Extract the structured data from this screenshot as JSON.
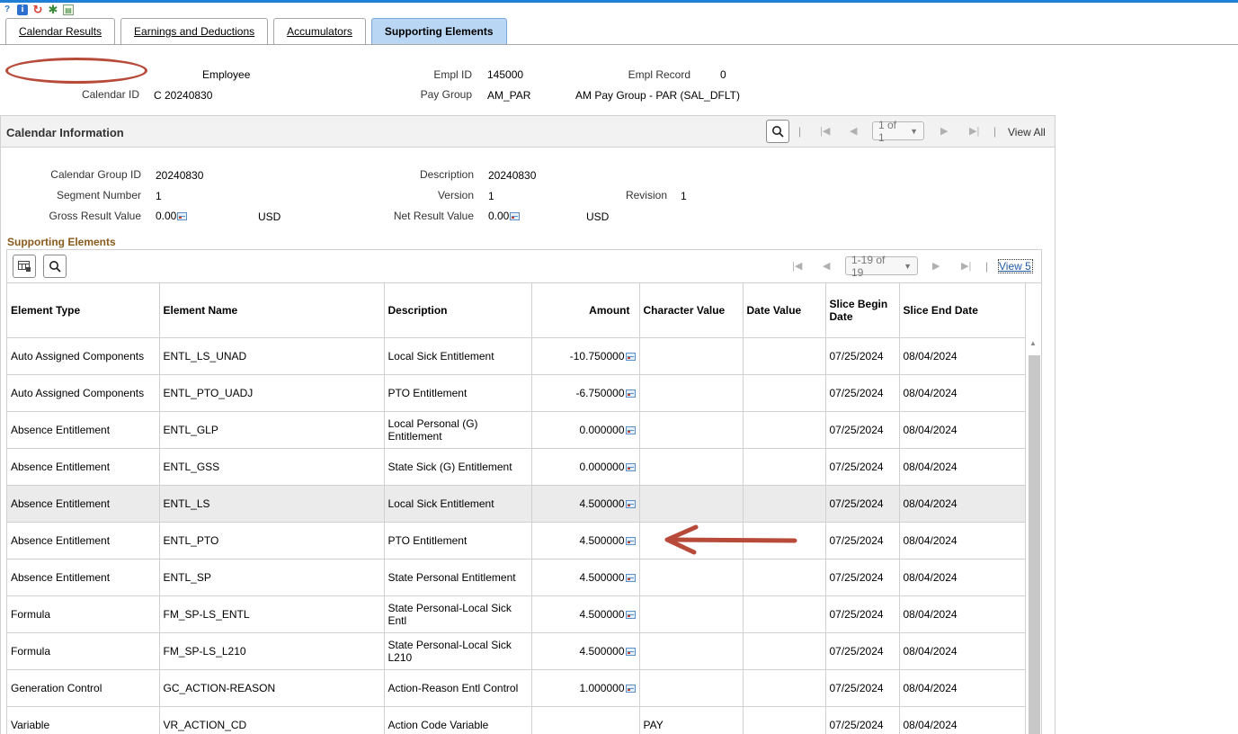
{
  "toolbar": {
    "icons": [
      "help-icon",
      "info-icon",
      "refresh-icon",
      "settings-icon",
      "report-icon"
    ],
    "info_glyph": "i"
  },
  "tabs": [
    {
      "label": "Calendar Results",
      "active": false
    },
    {
      "label": "Earnings and Deductions",
      "active": false
    },
    {
      "label": "Accumulators",
      "active": false
    },
    {
      "label": "Supporting Elements",
      "active": true
    }
  ],
  "header": {
    "employee_label": "Employee",
    "empl_id_label": "Empl ID",
    "empl_id": "145000",
    "empl_record_label": "Empl Record",
    "empl_record": "0",
    "calendar_id_label": "Calendar ID",
    "calendar_id": "C 20240830",
    "pay_group_label": "Pay Group",
    "pay_group": "AM_PAR",
    "pay_group_desc": "AM Pay Group - PAR (SAL_DFLT)"
  },
  "calendar_info": {
    "title": "Calendar Information",
    "pager": "1 of 1",
    "view_all": "View All",
    "calendar_group_id_label": "Calendar Group ID",
    "calendar_group_id": "20240830",
    "description_label": "Description",
    "description": "20240830",
    "segment_number_label": "Segment Number",
    "segment_number": "1",
    "version_label": "Version",
    "version": "1",
    "revision_label": "Revision",
    "revision": "1",
    "gross_result_label": "Gross Result Value",
    "gross_result": "0.00",
    "gross_currency": "USD",
    "net_result_label": "Net Result Value",
    "net_result": "0.00",
    "net_currency": "USD"
  },
  "supporting_elements": {
    "title": "Supporting Elements",
    "pager": "1-19 of 19",
    "view_link": "View 5",
    "columns": [
      "Element Type",
      "Element Name",
      "Description",
      "Amount",
      "Character Value",
      "Date Value",
      "Slice Begin Date",
      "Slice End Date"
    ],
    "rows": [
      {
        "type": "Auto Assigned Components",
        "name": "ENTL_LS_UNAD",
        "desc": "Local Sick Entitlement",
        "amount": "-10.750000",
        "char": "",
        "date": "",
        "begin": "07/25/2024",
        "end": "08/04/2024"
      },
      {
        "type": "Auto Assigned Components",
        "name": "ENTL_PTO_UADJ",
        "desc": "PTO Entitlement",
        "amount": "-6.750000",
        "char": "",
        "date": "",
        "begin": "07/25/2024",
        "end": "08/04/2024"
      },
      {
        "type": "Absence Entitlement",
        "name": "ENTL_GLP",
        "desc": "Local Personal (G) Entitlement",
        "amount": "0.000000",
        "char": "",
        "date": "",
        "begin": "07/25/2024",
        "end": "08/04/2024"
      },
      {
        "type": "Absence Entitlement",
        "name": "ENTL_GSS",
        "desc": "State Sick (G) Entitlement",
        "amount": "0.000000",
        "char": "",
        "date": "",
        "begin": "07/25/2024",
        "end": "08/04/2024"
      },
      {
        "type": "Absence Entitlement",
        "name": "ENTL_LS",
        "desc": "Local Sick Entitlement",
        "amount": "4.500000",
        "char": "",
        "date": "",
        "begin": "07/25/2024",
        "end": "08/04/2024"
      },
      {
        "type": "Absence Entitlement",
        "name": "ENTL_PTO",
        "desc": "PTO Entitlement",
        "amount": "4.500000",
        "char": "",
        "date": "",
        "begin": "07/25/2024",
        "end": "08/04/2024"
      },
      {
        "type": "Absence Entitlement",
        "name": "ENTL_SP",
        "desc": "State Personal Entitlement",
        "amount": "4.500000",
        "char": "",
        "date": "",
        "begin": "07/25/2024",
        "end": "08/04/2024"
      },
      {
        "type": "Formula",
        "name": "FM_SP-LS_ENTL",
        "desc": "State Personal-Local Sick Entl",
        "amount": "4.500000",
        "char": "",
        "date": "",
        "begin": "07/25/2024",
        "end": "08/04/2024"
      },
      {
        "type": "Formula",
        "name": "FM_SP-LS_L210",
        "desc": "State Personal-Local Sick L210",
        "amount": "4.500000",
        "char": "",
        "date": "",
        "begin": "07/25/2024",
        "end": "08/04/2024"
      },
      {
        "type": "Generation Control",
        "name": "GC_ACTION-REASON",
        "desc": "Action-Reason Entl Control",
        "amount": "1.000000",
        "char": "",
        "date": "",
        "begin": "07/25/2024",
        "end": "08/04/2024"
      },
      {
        "type": "Variable",
        "name": "VR_ACTION_CD",
        "desc": "Action Code Variable",
        "amount": "",
        "char": "PAY",
        "date": "",
        "begin": "07/25/2024",
        "end": "08/04/2024"
      }
    ]
  },
  "colors": {
    "accent_blue": "#1f7fd6",
    "active_tab": "#b9d7f4",
    "section_title": "#8a5a1c",
    "annotation_red": "#b84a3a",
    "highlight_row": "#ebebeb"
  }
}
